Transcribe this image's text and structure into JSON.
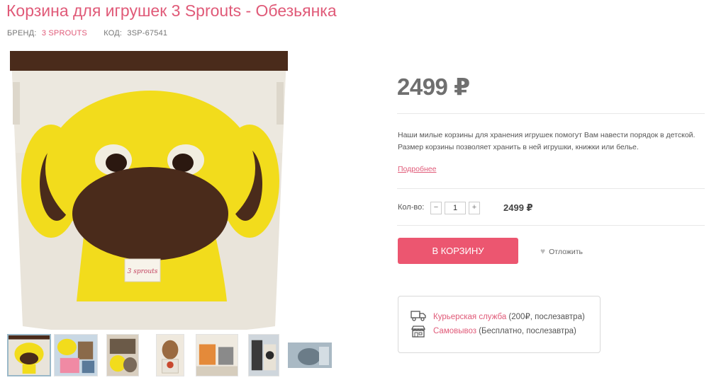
{
  "product": {
    "title": "Корзина для игрушек 3 Sprouts - Обезьянка",
    "brand_label": "Бренд:",
    "brand_value": "3 SPROUTS",
    "code_label": "Код:",
    "code_value": "3SP-67541",
    "tag_label": "3 sprouts"
  },
  "price": {
    "main": "2499 ₽",
    "description_line1": "Наши милые корзины для хранения игрушек помогут Вам навести порядок в детской.",
    "description_line2": "Размер корзины позволяет хранить в ней игрушки, книжки или белье.",
    "more_link": "Подробнее"
  },
  "quantity": {
    "label": "Кол-во:",
    "minus": "−",
    "value": "1",
    "plus": "+",
    "total": "2499 ₽"
  },
  "actions": {
    "add_to_cart": "В корзину",
    "wishlist": "Отложить",
    "wishlist_icon": "heart-icon"
  },
  "delivery": {
    "courier": {
      "icon": "truck-icon",
      "name": "Курьерская служба",
      "details": " (200₽, послезавтра)"
    },
    "pickup": {
      "icon": "store-icon",
      "name": "Самовывоз",
      "details": " (Бесплатно, послезавтра)"
    }
  },
  "colors": {
    "accent": "#e05a78",
    "button": "#ec5670",
    "monkey_yellow": "#f2dc1c",
    "monkey_brown": "#4a2b1b"
  }
}
